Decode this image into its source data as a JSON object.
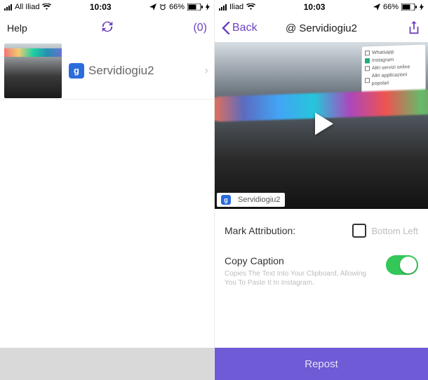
{
  "left": {
    "status": {
      "carrier": "All Iliad",
      "time": "10:03",
      "battery": "66%"
    },
    "nav": {
      "help": "Help",
      "count": "(0)"
    },
    "row": {
      "username": "Servidiogiu2",
      "avatar_letter": "g"
    }
  },
  "right": {
    "status": {
      "carrier": "Iliad",
      "time": "10:03",
      "battery": "66%"
    },
    "nav": {
      "back": "Back",
      "title": "@ Servidiogiu2"
    },
    "media": {
      "tag_username": "Servidiogiu2",
      "tag_avatar_letter": "g",
      "panel": {
        "opt1": "Whatsapp",
        "opt2": "Instagram",
        "opt3": "Altri servizi online",
        "opt4": "Altri applicazioni popolari"
      }
    },
    "settings": {
      "mark_label": "Mark Attribution:",
      "position": "Bottom Left",
      "copy_label": "Copy Caption",
      "copy_sub": "Copies The Text Into Your Clipboard, Allowing You To Paste It In Instagram."
    },
    "bottom": {
      "repost": "Repost"
    }
  },
  "colors": {
    "accent": "#6f42c1",
    "toggle_on": "#34c759",
    "repost_bg": "#6f5bd6"
  }
}
